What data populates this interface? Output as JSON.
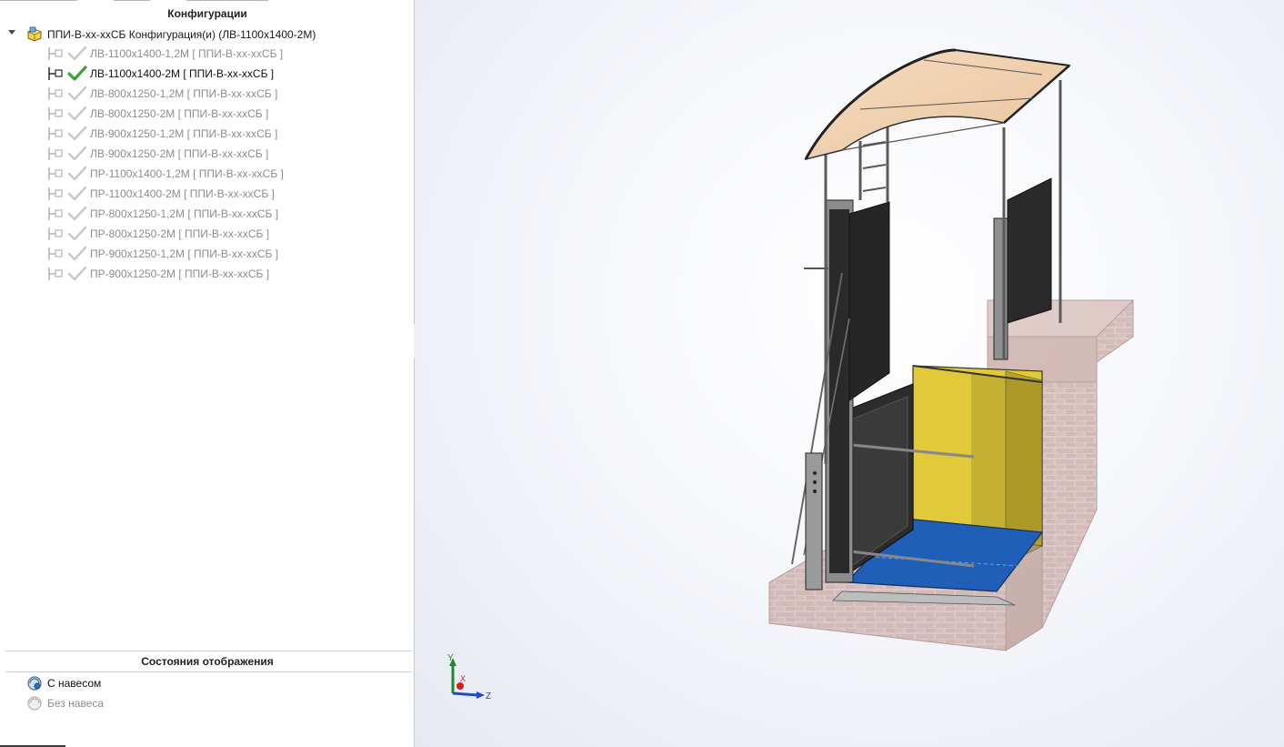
{
  "config_panel": {
    "title": "Конфигурации",
    "root": {
      "label": "ППИ-В-хх-ххСБ Конфигурация(и)  (ЛВ-1100х1400-2М)",
      "icon": "assembly-icon"
    },
    "configurations": [
      {
        "label": "ЛВ-1100х1400-1,2М [ ППИ-В-хх-ххСБ ]",
        "active": false
      },
      {
        "label": "ЛВ-1100х1400-2М [ ППИ-В-хх-ххСБ ]",
        "active": true
      },
      {
        "label": "ЛВ-800х1250-1,2М [ ППИ-В-хх-ххСБ ]",
        "active": false
      },
      {
        "label": "ЛВ-800х1250-2М [ ППИ-В-хх-ххСБ ]",
        "active": false
      },
      {
        "label": "ЛВ-900х1250-1,2М [ ППИ-В-хх-ххСБ ]",
        "active": false
      },
      {
        "label": "ЛВ-900х1250-2М [ ППИ-В-хх-ххСБ ]",
        "active": false
      },
      {
        "label": "ПР-1100х1400-1,2М [ ППИ-В-хх-ххСБ ]",
        "active": false
      },
      {
        "label": "ПР-1100х1400-2М [ ППИ-В-хх-ххСБ ]",
        "active": false
      },
      {
        "label": "ПР-800х1250-1,2М [ ППИ-В-хх-ххСБ ]",
        "active": false
      },
      {
        "label": "ПР-800х1250-2М [ ППИ-В-хх-ххСБ ]",
        "active": false
      },
      {
        "label": "ПР-900х1250-1,2М [ ППИ-В-хх-ххСБ ]",
        "active": false
      },
      {
        "label": "ПР-900х1250-2М [ ППИ-В-хх-ххСБ ]",
        "active": false
      }
    ]
  },
  "display_states": {
    "title": "Состояния отображения",
    "items": [
      {
        "label": "С навесом",
        "active": true
      },
      {
        "label": "Без навеса",
        "active": false
      }
    ]
  },
  "triad": {
    "x_label": "X",
    "y_label": "Y",
    "z_label": "Z"
  },
  "colors": {
    "active_text": "#111111",
    "inactive_text": "#8d8d8d",
    "check_active": "#3aa336",
    "check_inactive": "#c8c8c8",
    "platform_floor": "#1f5fb8",
    "shaft_wall": "#e1c93a",
    "canopy": "#f2d6b4",
    "brick": "#a87a72"
  }
}
